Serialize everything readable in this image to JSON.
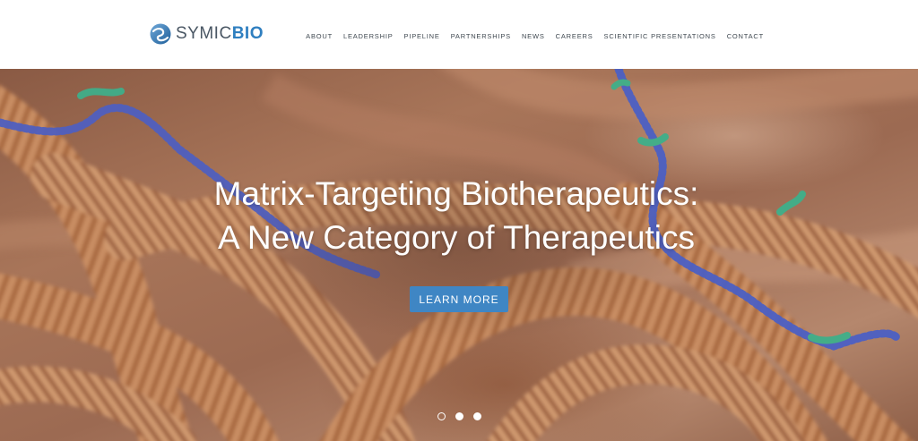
{
  "brand": {
    "name_part1": "SYMIC",
    "name_part2": "BIO",
    "logo_icon": "symicbio-swirl-icon",
    "colors": {
      "gray": "#4a5764",
      "blue": "#2f7fc0"
    }
  },
  "nav": {
    "items": [
      {
        "label": "ABOUT"
      },
      {
        "label": "LEADERSHIP"
      },
      {
        "label": "PIPELINE"
      },
      {
        "label": "PARTNERSHIPS"
      },
      {
        "label": "NEWS"
      },
      {
        "label": "CAREERS"
      },
      {
        "label": "SCIENTIFIC PRESENTATIONS"
      },
      {
        "label": "CONTACT"
      }
    ]
  },
  "hero": {
    "title_line1": "Matrix-Targeting Biotherapeutics:",
    "title_line2": "A New Category of Therapeutics",
    "cta_label": "LEARN MORE",
    "cta_color": "#3f86c4",
    "slides": {
      "count": 3,
      "active": 1
    }
  }
}
